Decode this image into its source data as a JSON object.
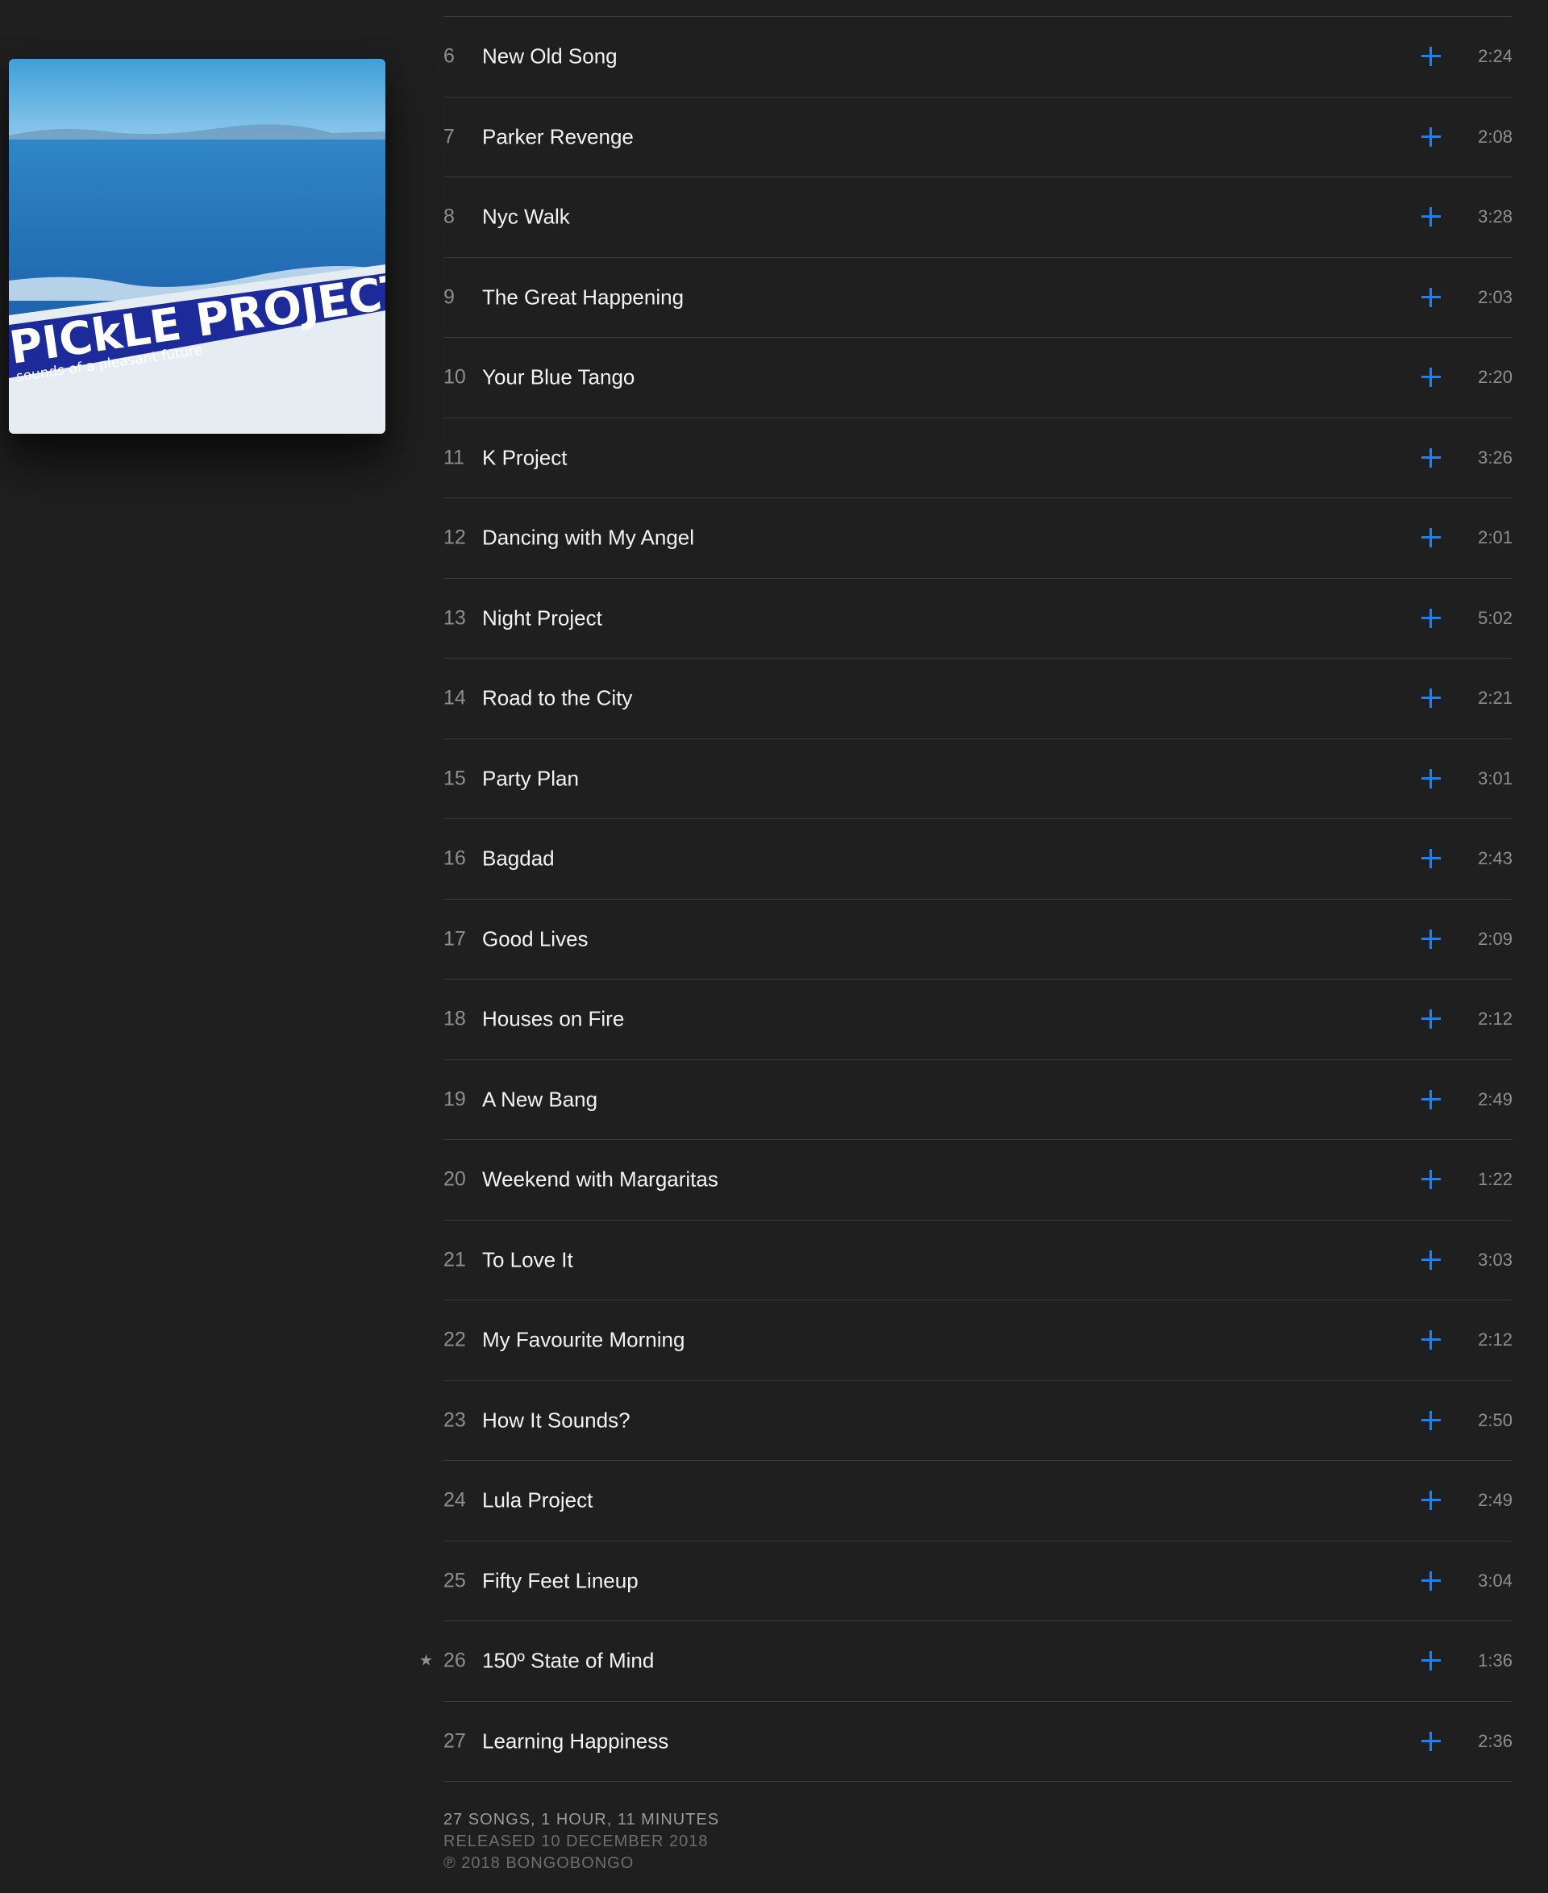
{
  "album": {
    "artwork_title": "PICkLE PROJECT",
    "artwork_subtitle": "sounds of a pleasant future",
    "colors": {
      "sky": "#5fb3e0",
      "sea": "#1e6fb5",
      "band": "#1c2a9a",
      "paper": "#e8eef2"
    }
  },
  "accent_color": "#1a82f7",
  "add_icon": "plus-icon",
  "tracks": [
    {
      "number": "6",
      "title": "New Old Song",
      "duration": "2:24",
      "starred": false
    },
    {
      "number": "7",
      "title": "Parker Revenge",
      "duration": "2:08",
      "starred": false
    },
    {
      "number": "8",
      "title": "Nyc Walk",
      "duration": "3:28",
      "starred": false
    },
    {
      "number": "9",
      "title": "The Great Happening",
      "duration": "2:03",
      "starred": false
    },
    {
      "number": "10",
      "title": "Your Blue Tango",
      "duration": "2:20",
      "starred": false
    },
    {
      "number": "11",
      "title": "K Project",
      "duration": "3:26",
      "starred": false
    },
    {
      "number": "12",
      "title": "Dancing with My Angel",
      "duration": "2:01",
      "starred": false
    },
    {
      "number": "13",
      "title": "Night Project",
      "duration": "5:02",
      "starred": false
    },
    {
      "number": "14",
      "title": "Road to the City",
      "duration": "2:21",
      "starred": false
    },
    {
      "number": "15",
      "title": "Party Plan",
      "duration": "3:01",
      "starred": false
    },
    {
      "number": "16",
      "title": "Bagdad",
      "duration": "2:43",
      "starred": false
    },
    {
      "number": "17",
      "title": "Good Lives",
      "duration": "2:09",
      "starred": false
    },
    {
      "number": "18",
      "title": "Houses on Fire",
      "duration": "2:12",
      "starred": false
    },
    {
      "number": "19",
      "title": "A New Bang",
      "duration": "2:49",
      "starred": false
    },
    {
      "number": "20",
      "title": "Weekend with Margaritas",
      "duration": "1:22",
      "starred": false
    },
    {
      "number": "21",
      "title": "To Love It",
      "duration": "3:03",
      "starred": false
    },
    {
      "number": "22",
      "title": "My Favourite Morning",
      "duration": "2:12",
      "starred": false
    },
    {
      "number": "23",
      "title": "How It Sounds?",
      "duration": "2:50",
      "starred": false
    },
    {
      "number": "24",
      "title": "Lula Project",
      "duration": "2:49",
      "starred": false
    },
    {
      "number": "25",
      "title": "Fifty Feet Lineup",
      "duration": "3:04",
      "starred": false
    },
    {
      "number": "26",
      "title": "150º State of Mind",
      "duration": "1:36",
      "starred": true
    },
    {
      "number": "27",
      "title": "Learning Happiness",
      "duration": "2:36",
      "starred": false
    }
  ],
  "star_glyph": "★",
  "footer": {
    "summary": "27 SONGS, 1 HOUR, 11 MINUTES",
    "released": "RELEASED  10 DECEMBER 2018",
    "copyright": "℗ 2018 BONGOBONGO"
  }
}
